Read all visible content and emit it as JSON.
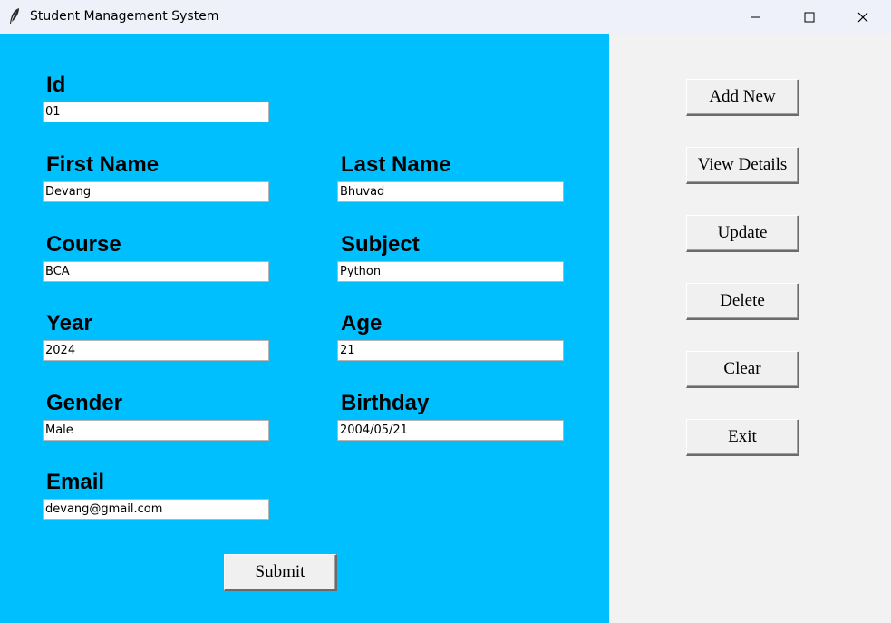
{
  "window": {
    "title": "Student Management System"
  },
  "form": {
    "fields": {
      "id": {
        "label": "Id",
        "value": "01"
      },
      "first_name": {
        "label": "First Name",
        "value": "Devang"
      },
      "last_name": {
        "label": "Last Name",
        "value": "Bhuvad"
      },
      "course": {
        "label": "Course",
        "value": "BCA"
      },
      "subject": {
        "label": "Subject",
        "value": "Python"
      },
      "year": {
        "label": "Year",
        "value": "2024"
      },
      "age": {
        "label": "Age",
        "value": "21"
      },
      "gender": {
        "label": "Gender",
        "value": "Male"
      },
      "birthday": {
        "label": "Birthday",
        "value": "2004/05/21"
      },
      "email": {
        "label": "Email",
        "value": "devang@gmail.com"
      }
    },
    "submit_label": "Submit"
  },
  "actions": {
    "add_new": "Add New",
    "view_details": "View Details",
    "update": "Update",
    "delete": "Delete",
    "clear": "Clear",
    "exit": "Exit"
  },
  "colors": {
    "form_background": "#00bfff",
    "actions_background": "#f2f2f2",
    "titlebar_background": "#eef1f9"
  },
  "icons": {
    "app": "feather-icon",
    "minimize": "minimize-icon",
    "maximize": "maximize-icon",
    "close": "close-icon"
  }
}
